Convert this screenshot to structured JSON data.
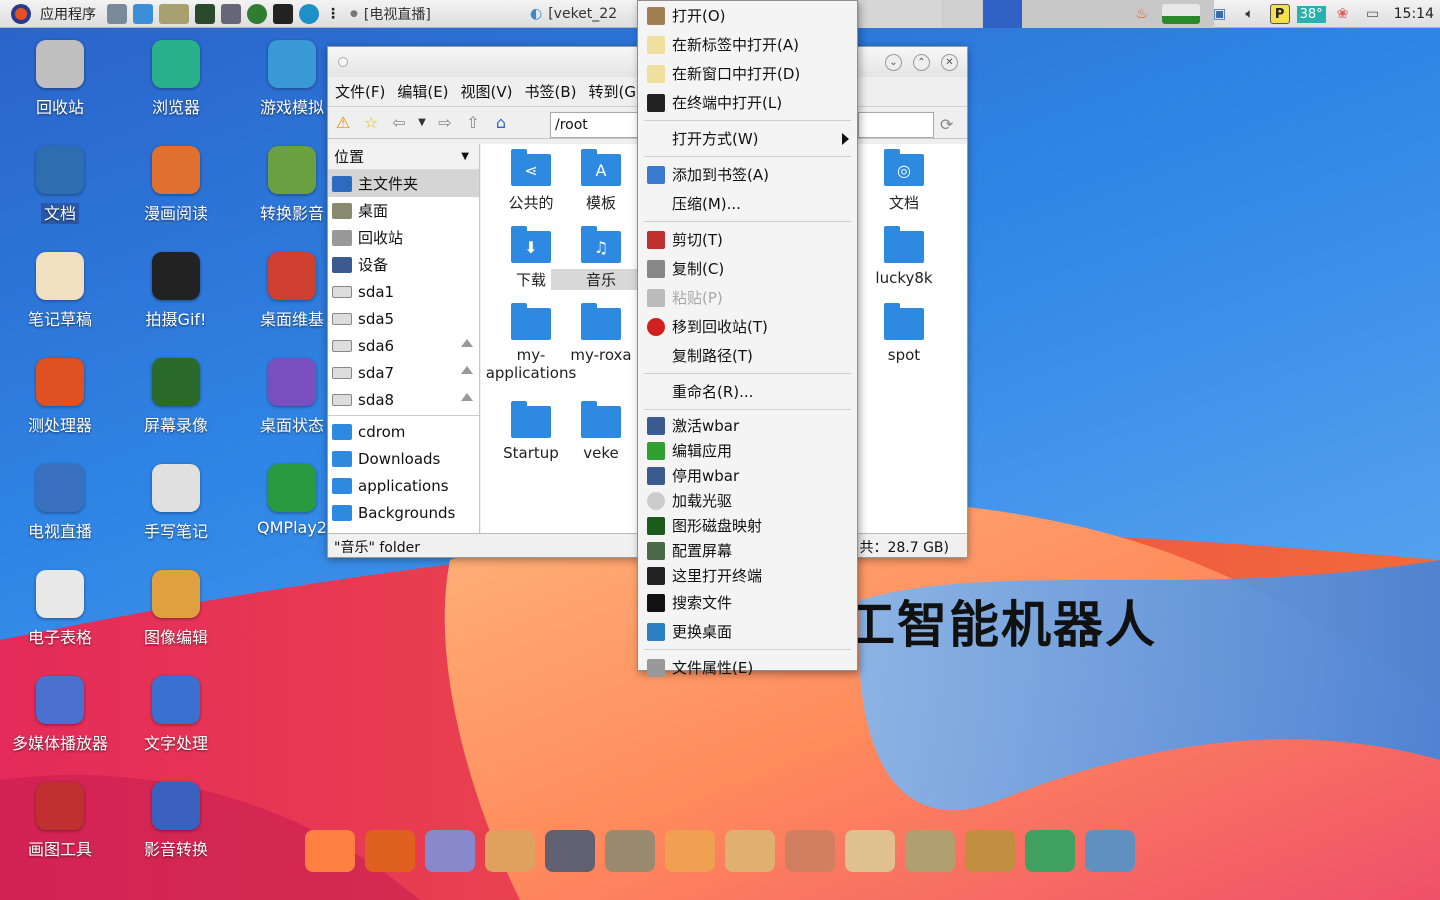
{
  "taskbar": {
    "start_label": "应用程序",
    "tasks": [
      "[电视直播]",
      "[veket_22"
    ],
    "clock": "15:14",
    "temperature": "38°"
  },
  "desktop": {
    "title_text": "工智能机器人",
    "icons": [
      {
        "label": "回收站",
        "icon": "trash-icon"
      },
      {
        "label": "浏览器",
        "icon": "globe-icon"
      },
      {
        "label": "游戏模拟",
        "icon": "dolphin-icon"
      },
      {
        "label": "文档",
        "icon": "documents-folder-icon"
      },
      {
        "label": "漫画阅读",
        "icon": "monkey-icon"
      },
      {
        "label": "转换影音",
        "icon": "convert-media-icon"
      },
      {
        "label": "笔记草稿",
        "icon": "notes-icon"
      },
      {
        "label": "拍摄Gif!",
        "icon": "camera-icon"
      },
      {
        "label": "桌面维基",
        "icon": "wiki-icon"
      },
      {
        "label": "测处理器",
        "icon": "cpu-test-icon"
      },
      {
        "label": "屏幕录像",
        "icon": "screen-record-icon"
      },
      {
        "label": "桌面状态",
        "icon": "desktop-status-icon"
      },
      {
        "label": "电视直播",
        "icon": "tv-icon"
      },
      {
        "label": "手写笔记",
        "icon": "handwriting-icon"
      },
      {
        "label": "QMPlay2",
        "icon": "play-icon"
      },
      {
        "label": "电子表格",
        "icon": "spreadsheet-icon"
      },
      {
        "label": "图像编辑",
        "icon": "palette-icon"
      },
      {
        "label": "多媒体播放器",
        "icon": "media-player-icon"
      },
      {
        "label": "文字处理",
        "icon": "word-processor-icon"
      },
      {
        "label": "画图工具",
        "icon": "paint-icon"
      },
      {
        "label": "影音转换",
        "icon": "video-convert-icon"
      }
    ]
  },
  "file_manager": {
    "menu": [
      "文件(F)",
      "编辑(E)",
      "视图(V)",
      "书签(B)",
      "转到(G"
    ],
    "path": "/root",
    "sidebar_header": "位置",
    "sidebar": [
      {
        "label": "主文件夹",
        "icon": "home-icon",
        "selected": true
      },
      {
        "label": "桌面",
        "icon": "desktop-icon"
      },
      {
        "label": "回收站",
        "icon": "trash-icon"
      },
      {
        "label": "设备",
        "icon": "computer-icon"
      },
      {
        "label": "sda1",
        "icon": "drive-icon"
      },
      {
        "label": "sda5",
        "icon": "drive-icon"
      },
      {
        "label": "sda6",
        "icon": "drive-icon",
        "eject": true
      },
      {
        "label": "sda7",
        "icon": "drive-icon",
        "eject": true
      },
      {
        "label": "sda8",
        "icon": "drive-icon",
        "eject": true
      }
    ],
    "bookmarks": [
      "cdrom",
      "Downloads",
      "applications",
      "Backgrounds"
    ],
    "files": [
      {
        "label": "公共的",
        "glyph": "share-icon"
      },
      {
        "label": "模板",
        "glyph": "template-icon"
      },
      {
        "label": "文档",
        "glyph": "doc-icon"
      },
      {
        "label": "下载",
        "glyph": "download-icon"
      },
      {
        "label": "音乐",
        "glyph": "music-icon"
      },
      {
        "label": "lucky8k",
        "glyph": ""
      },
      {
        "label": "my-\napplications",
        "glyph": ""
      },
      {
        "label": "my-roxa",
        "glyph": ""
      },
      {
        "label": "spot",
        "glyph": "link-icon"
      },
      {
        "label": "Startup",
        "glyph": ""
      },
      {
        "label": "veke",
        "glyph": ""
      }
    ],
    "status_left": "\"音乐\" folder",
    "status_right": "共：28.7 GB)"
  },
  "context_menu": {
    "items": [
      {
        "label": "打开(O)",
        "icon": "folder-open-icon"
      },
      {
        "label": "在新标签中打开(A)",
        "icon": "new-tab-icon"
      },
      {
        "label": "在新窗口中打开(D)",
        "icon": "new-window-icon"
      },
      {
        "label": "在终端中打开(L)",
        "icon": "terminal-icon"
      },
      {
        "sep": true
      },
      {
        "label": "打开方式(W)",
        "submenu": true
      },
      {
        "sep": true
      },
      {
        "label": "添加到书签(A)",
        "icon": "add-icon"
      },
      {
        "label": "压缩(M)..."
      },
      {
        "sep": true
      },
      {
        "label": "剪切(T)",
        "icon": "scissors-icon"
      },
      {
        "label": "复制(C)",
        "icon": "copy-icon"
      },
      {
        "label": "粘贴(P)",
        "icon": "paste-icon",
        "disabled": true
      },
      {
        "label": "移到回收站(T)",
        "icon": "delete-icon"
      },
      {
        "label": "复制路径(T)"
      },
      {
        "sep": true
      },
      {
        "label": "重命名(R)..."
      },
      {
        "sep": true
      },
      {
        "label": "激活wbar",
        "icon": "wbar-icon",
        "small": true
      },
      {
        "label": "编辑应用",
        "icon": "check-icon",
        "small": true
      },
      {
        "label": "停用wbar",
        "icon": "wbar-icon",
        "small": true
      },
      {
        "label": "加载光驱",
        "icon": "disc-icon",
        "small": true
      },
      {
        "label": "图形磁盘映射",
        "icon": "disk-map-icon",
        "small": true
      },
      {
        "label": "配置屏幕",
        "icon": "monitor-icon",
        "small": true
      },
      {
        "label": "这里打开终端",
        "icon": "terminal-icon",
        "small": true
      },
      {
        "label": "搜索文件",
        "icon": "search-icon"
      },
      {
        "label": "更换桌面",
        "icon": "wallpaper-icon"
      },
      {
        "sep": true
      },
      {
        "label": "文件属性(E)",
        "icon": "properties-icon"
      }
    ]
  },
  "colors": {
    "accent": "#2e8ae0",
    "wall_red": "#e8304a",
    "wall_orange": "#ff9a55"
  }
}
